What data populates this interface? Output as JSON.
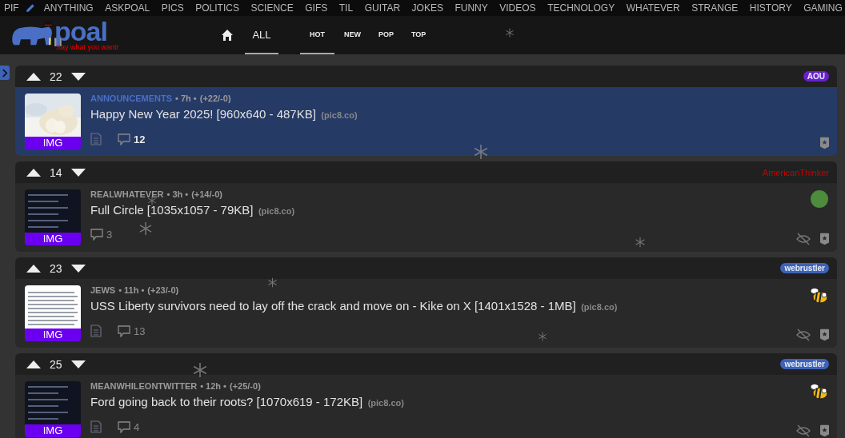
{
  "nav": {
    "items": [
      {
        "label": "PIF",
        "kind": "link"
      },
      {
        "kind": "edit"
      },
      {
        "label": "ANYTHING",
        "kind": "link"
      },
      {
        "label": "ASKPOAL",
        "kind": "link"
      },
      {
        "label": "PICS",
        "kind": "link"
      },
      {
        "label": "POLITICS",
        "kind": "link"
      },
      {
        "label": "SCIENCE",
        "kind": "link"
      },
      {
        "label": "GIFS",
        "kind": "link"
      },
      {
        "label": "TIL",
        "kind": "link"
      },
      {
        "label": "GUITAR",
        "kind": "link"
      },
      {
        "label": "JOKES",
        "kind": "link"
      },
      {
        "label": "FUNNY",
        "kind": "link"
      },
      {
        "label": "VIDEOS",
        "kind": "link"
      },
      {
        "label": "TECHNOLOGY",
        "kind": "link"
      },
      {
        "label": "WHATEVER",
        "kind": "link"
      },
      {
        "label": "STRANGE",
        "kind": "link"
      },
      {
        "label": "HISTORY",
        "kind": "link"
      },
      {
        "label": "GAMING",
        "kind": "link"
      }
    ]
  },
  "logo": {
    "name": "poal",
    "tagline": "Say what you want!"
  },
  "scope_tabs": [
    {
      "label": "ALL",
      "selected": true
    }
  ],
  "sort_tabs": [
    {
      "label": "HOT",
      "selected": true
    },
    {
      "label": "NEW",
      "selected": false
    },
    {
      "label": "POP",
      "selected": false
    },
    {
      "label": "TOP",
      "selected": false
    }
  ],
  "posts": [
    {
      "score": "22",
      "highlighted": true,
      "community": "ANNOUNCEMENTS",
      "time": "• 7h •",
      "votes": "(+22/-0)",
      "title": "Happy New Year 2025! [960x640 - 487KB]",
      "domain": "(pic8.co)",
      "thumb": {
        "label": "IMG"
      },
      "has_text": true,
      "comments": "12",
      "user": {
        "name": "AOU",
        "kind": "pill",
        "color": "#6a1fd0"
      },
      "hideable": false
    },
    {
      "score": "14",
      "highlighted": false,
      "community": "REALWHATEVER",
      "time": "• 3h •",
      "votes": "(+14/-0)",
      "title": "Full Circle [1035x1057 - 79KB]",
      "domain": "(pic8.co)",
      "thumb": {
        "kind": "dark-document",
        "label": "IMG"
      },
      "has_text": false,
      "comments": "3",
      "user": {
        "name": "AmericanThinker",
        "kind": "text",
        "color": "#c80000"
      },
      "avatar": {
        "kind": "green"
      },
      "hideable": true
    },
    {
      "score": "23",
      "highlighted": false,
      "community": "JEWS",
      "time": "• 11h •",
      "votes": "(+23/-0)",
      "title": "USS Liberty survivors need to lay off the crack and move on - Kike on X [1401x1528 - 1MB]",
      "domain": "(pic8.co)",
      "thumb": {
        "kind": "light-document",
        "label": "IMG"
      },
      "has_text": true,
      "comments": "13",
      "user": {
        "name": "webrustler",
        "kind": "pill",
        "color": "#3d62b8"
      },
      "avatar": {
        "kind": "bee"
      },
      "hideable": true
    },
    {
      "score": "25",
      "highlighted": false,
      "community": "MEANWHILEONTWITTER",
      "time": "• 12h •",
      "votes": "(+25/-0)",
      "title": "Ford going back to their roots? [1070x619 - 172KB]",
      "domain": "(pic8.co)",
      "thumb": {
        "kind": "dark-document",
        "label": "IMG"
      },
      "has_text": true,
      "comments": "4",
      "user": {
        "name": "webrustler",
        "kind": "pill",
        "color": "#3d62b8"
      },
      "avatar": {
        "kind": "bee"
      },
      "hideable": true
    }
  ]
}
